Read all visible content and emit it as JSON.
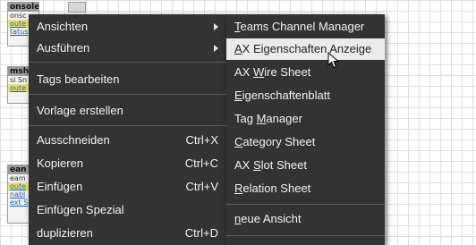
{
  "background": {
    "nodes": [
      {
        "header": "onsoleKecI",
        "rows": [
          "onsc",
          "oute",
          "tatus"
        ]
      },
      {
        "header": "msh",
        "rows": [
          "si Sn",
          "oute"
        ]
      },
      {
        "header": "ean",
        "rows": [
          "eam",
          "oute",
          "nabl",
          "ext S"
        ]
      }
    ],
    "header_icon": "resize-handle-icon"
  },
  "context_menu": {
    "items": [
      {
        "label": "Ansichten",
        "has_submenu": true
      },
      {
        "label": "Ausführen",
        "has_submenu": true
      },
      {
        "label": "Tags bearbeiten"
      },
      {
        "label": "Vorlage erstellen"
      },
      {
        "label": "Ausschneiden",
        "shortcut": "Ctrl+X"
      },
      {
        "label": "Kopieren",
        "shortcut": "Ctrl+C"
      },
      {
        "label": "Einfügen",
        "shortcut": "Ctrl+V"
      },
      {
        "label": "Einfügen Spezial"
      },
      {
        "label": "duplizieren",
        "shortcut": "Ctrl+D"
      }
    ]
  },
  "submenu": {
    "items": [
      {
        "pre": "",
        "mn": "T",
        "post": "eams Channel Manager"
      },
      {
        "pre": "",
        "mn": "A",
        "post": "X Eigenschaften Anzeige",
        "hovered": true
      },
      {
        "pre": "AX ",
        "mn": "W",
        "post": "ire Sheet"
      },
      {
        "pre": "",
        "mn": "E",
        "post": "igenschaftenblatt"
      },
      {
        "pre": "Tag ",
        "mn": "M",
        "post": "anager"
      },
      {
        "pre": "",
        "mn": "C",
        "post": "ategory Sheet"
      },
      {
        "pre": "AX ",
        "mn": "S",
        "post": "lot Sheet"
      },
      {
        "pre": "",
        "mn": "R",
        "post": "elation Sheet"
      },
      {
        "pre": "",
        "mn": "n",
        "post": "eue Ansicht"
      }
    ]
  },
  "colors": {
    "menu_bg": "#333333",
    "menu_text": "#f2f2f2",
    "hover_bg": "#ebebeb"
  },
  "cursor_icon": "mouse-pointer-icon"
}
